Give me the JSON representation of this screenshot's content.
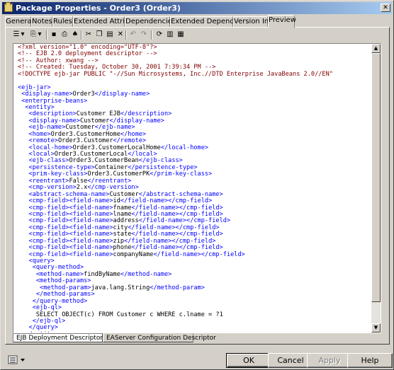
{
  "window": {
    "title": "Package Properties - Order3 (Order3)"
  },
  "tabs": [
    "General",
    "Notes",
    "Rules",
    "Extended Attributes",
    "Dependencies",
    "Extended Dependencies",
    "Version Info",
    "Preview"
  ],
  "active_tab": "Preview",
  "toolbar_icons": [
    "properties-icon",
    "dropdown-icon",
    "copy-doc-icon",
    "dropdown-icon",
    "save-icon",
    "print-icon",
    "find-icon",
    "cut-icon",
    "copy-icon",
    "paste-icon",
    "delete-icon",
    "undo-icon",
    "redo-icon",
    "refresh-icon",
    "columns-icon",
    "list-icon"
  ],
  "code_lines": [
    "<?xml version=\"1.0\" encoding=\"UTF-8\"?>",
    "<!-- EJB 2.0 deployment descriptor -->",
    "<!-- Author: xwang -->",
    "<!-- Created: Tuesday, October 30, 2001 7:39:34 PM -->",
    "<!DOCTYPE ejb-jar PUBLIC \"-//Sun Microsystems, Inc.//DTD Enterprise JavaBeans 2.0//EN\"",
    "",
    "<ejb-jar>",
    " <display-name>Order3</display-name>",
    " <enterprise-beans>",
    "  <entity>",
    "   <description>Customer EJB</description>",
    "   <display-name>Customer</display-name>",
    "   <ejb-name>Customer</ejb-name>",
    "   <home>Order3.CustomerHome</home>",
    "   <remote>Order3.Customer</remote>",
    "   <local-home>Order3.CustomerLocalHome</local-home>",
    "   <local>Order3.CustomerLocal</local>",
    "   <ejb-class>Order3.CustomerBean</ejb-class>",
    "   <persistence-type>Container</persistence-type>",
    "   <prim-key-class>Order3.CustomerPK</prim-key-class>",
    "   <reentrant>False</reentrant>",
    "   <cmp-version>2.x</cmp-version>",
    "   <abstract-schema-name>Customer</abstract-schema-name>",
    "   <cmp-field><field-name>id</field-name></cmp-field>",
    "   <cmp-field><field-name>fname</field-name></cmp-field>",
    "   <cmp-field><field-name>lname</field-name></cmp-field>",
    "   <cmp-field><field-name>address</field-name></cmp-field>",
    "   <cmp-field><field-name>city</field-name></cmp-field>",
    "   <cmp-field><field-name>state</field-name></cmp-field>",
    "   <cmp-field><field-name>zip</field-name></cmp-field>",
    "   <cmp-field><field-name>phone</field-name></cmp-field>",
    "   <cmp-field><field-name>companyName</field-name></cmp-field>",
    "   <query>",
    "    <query-method>",
    "     <method-name>findByName</method-name>",
    "     <method-params>",
    "      <method-param>java.lang.String</method-param>",
    "     </method-params>",
    "    </query-method>",
    "    <ejb-ql>",
    "     SELECT OBJECT(c) FROM Customer c WHERE c.lname = ?1",
    "    </ejb-ql>",
    "   </query>",
    "  </entity>"
  ],
  "sub_tabs": [
    "EJB Deployment Descriptor",
    "EAServer Configuration Descriptor"
  ],
  "buttons": {
    "ok": "OK",
    "cancel": "Cancel",
    "apply": "Apply",
    "help": "Help"
  },
  "colors": {
    "tag": "#0000ff",
    "comment": "#800000",
    "title_start": "#0a246a",
    "title_end": "#a6caf0"
  }
}
